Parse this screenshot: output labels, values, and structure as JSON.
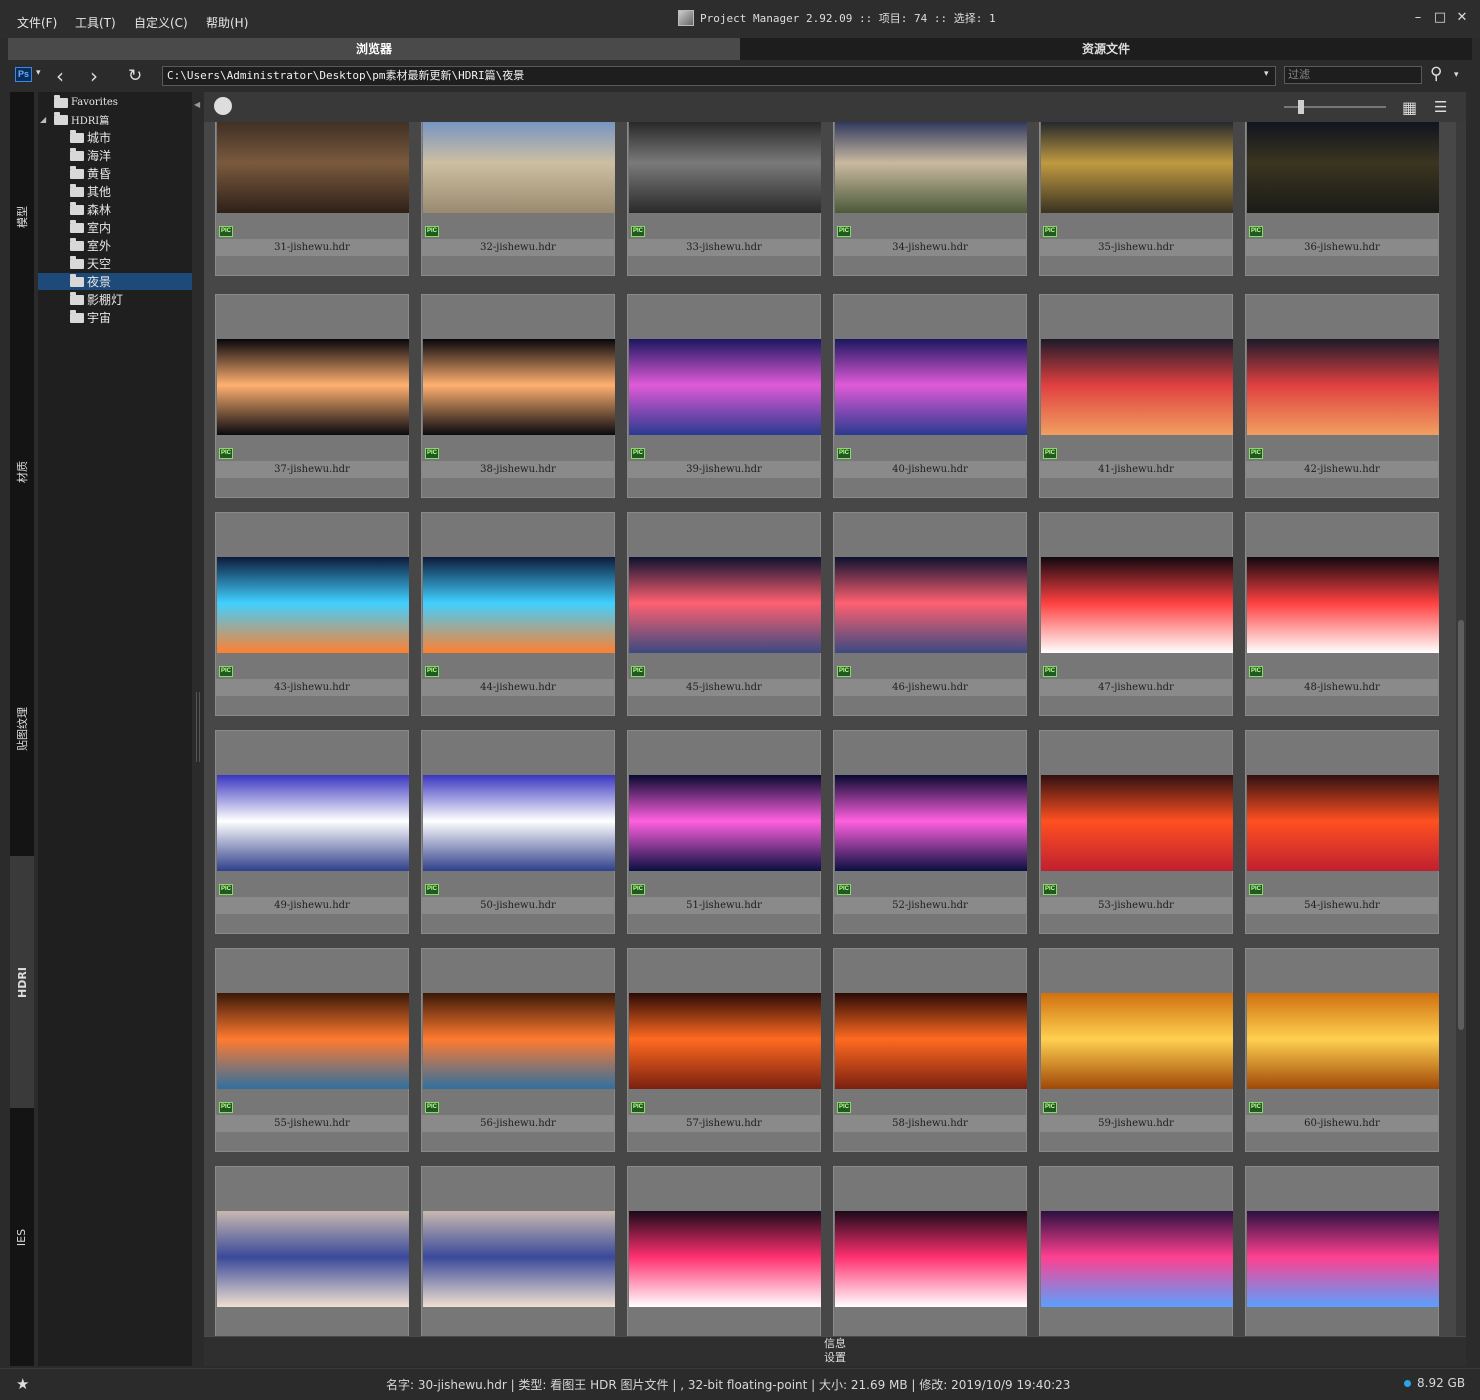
{
  "menu": [
    "文件(F)",
    "工具(T)",
    "自定义(C)",
    "帮助(H)"
  ],
  "app_title": "Project Manager 2.92.09  :: 项目: 74  :: 选择: 1",
  "main_tabs": [
    "浏览器",
    "资源文件"
  ],
  "toolbar": {
    "ps_label": "Ps",
    "path": "C:\\Users\\Administrator\\Desktop\\pm素材最新更新\\HDRI篇\\夜景",
    "filter_placeholder": "过滤"
  },
  "side_tabs": [
    "模型",
    "材质",
    "贴图纹理",
    "HDRI",
    "IES"
  ],
  "tree": {
    "favorites": "Favorites",
    "root": "HDRI篇",
    "folders": [
      "城市",
      "海洋",
      "黄昏",
      "其他",
      "森林",
      "室内",
      "室外",
      "天空",
      "夜景",
      "影棚灯",
      "宇宙"
    ],
    "selected": "夜景"
  },
  "pic_badge": "PIC",
  "files": [
    "31-jishewu.hdr",
    "32-jishewu.hdr",
    "33-jishewu.hdr",
    "34-jishewu.hdr",
    "35-jishewu.hdr",
    "36-jishewu.hdr",
    "37-jishewu.hdr",
    "38-jishewu.hdr",
    "39-jishewu.hdr",
    "40-jishewu.hdr",
    "41-jishewu.hdr",
    "42-jishewu.hdr",
    "43-jishewu.hdr",
    "44-jishewu.hdr",
    "45-jishewu.hdr",
    "46-jishewu.hdr",
    "47-jishewu.hdr",
    "48-jishewu.hdr",
    "49-jishewu.hdr",
    "50-jishewu.hdr",
    "51-jishewu.hdr",
    "52-jishewu.hdr",
    "53-jishewu.hdr",
    "54-jishewu.hdr",
    "55-jishewu.hdr",
    "56-jishewu.hdr",
    "57-jishewu.hdr",
    "58-jishewu.hdr",
    "59-jishewu.hdr",
    "60-jishewu.hdr",
    "",
    "",
    "",
    "",
    "",
    ""
  ],
  "thumb_colors": [
    [
      "#3a2b22",
      "#7a5a3e",
      "#2e2118"
    ],
    [
      "#6f90c6",
      "#cdbfa2",
      "#9a8a70"
    ],
    [
      "#1f1f1f",
      "#7a7a7a",
      "#2a2a2a"
    ],
    [
      "#1e2a55",
      "#c9b9a0",
      "#4b5a3a"
    ],
    [
      "#111a2a",
      "#c09a40",
      "#3a3322"
    ],
    [
      "#0c1020",
      "#3a3520",
      "#1b1b18"
    ],
    [
      "#06060c",
      "#ffb070",
      "#0a0a10"
    ],
    [
      "#06060c",
      "#ffb070",
      "#0a0a10"
    ],
    [
      "#1a1760",
      "#e05ad8",
      "#2a3a90"
    ],
    [
      "#1a1760",
      "#e05ad8",
      "#2a3a90"
    ],
    [
      "#1c1a2a",
      "#e04040",
      "#f0a060"
    ],
    [
      "#1c1a2a",
      "#e04040",
      "#f0a060"
    ],
    [
      "#0d1a3a",
      "#40d0ff",
      "#ff8030"
    ],
    [
      "#0d1a3a",
      "#40d0ff",
      "#ff8030"
    ],
    [
      "#0c1230",
      "#ff6070",
      "#3a4a80"
    ],
    [
      "#0c1230",
      "#ff6070",
      "#3a4a80"
    ],
    [
      "#100810",
      "#ff4040",
      "#ffffff"
    ],
    [
      "#100810",
      "#ff4040",
      "#ffffff"
    ],
    [
      "#3a36c0",
      "#ffffff",
      "#30408a"
    ],
    [
      "#3a36c0",
      "#ffffff",
      "#30408a"
    ],
    [
      "#070a30",
      "#ff60e0",
      "#0a1040"
    ],
    [
      "#070a30",
      "#ff60e0",
      "#0a1040"
    ],
    [
      "#301010",
      "#ff5020",
      "#c02030"
    ],
    [
      "#301010",
      "#ff5020",
      "#c02030"
    ],
    [
      "#3a1808",
      "#ff7a30",
      "#3070a0"
    ],
    [
      "#3a1808",
      "#ff7a30",
      "#3070a0"
    ],
    [
      "#2a0a06",
      "#ff6a20",
      "#7a2010"
    ],
    [
      "#2a0a06",
      "#ff6a20",
      "#7a2010"
    ],
    [
      "#d07010",
      "#ffd050",
      "#a04808"
    ],
    [
      "#d07010",
      "#ffd050",
      "#a04808"
    ],
    [
      "#c8b8b0",
      "#3a4a9a",
      "#f0e0d0"
    ],
    [
      "#c8b8b0",
      "#3a4a9a",
      "#f0e0d0"
    ],
    [
      "#1a0a1a",
      "#ff3070",
      "#ffffff"
    ],
    [
      "#1a0a1a",
      "#ff3070",
      "#ffffff"
    ],
    [
      "#2a1040",
      "#ff4090",
      "#5aa0ff"
    ],
    [
      "#2a1040",
      "#ff4090",
      "#5aa0ff"
    ]
  ],
  "panel": {
    "info": "信息",
    "settings": "设置"
  },
  "status": {
    "info": "名字: 30-jishewu.hdr | 类型: 看图王 HDR 图片文件 | , 32-bit floating-point | 大小: 21.69 MB | 修改: 2019/10/9 19:40:23",
    "disk": "8.92 GB"
  }
}
